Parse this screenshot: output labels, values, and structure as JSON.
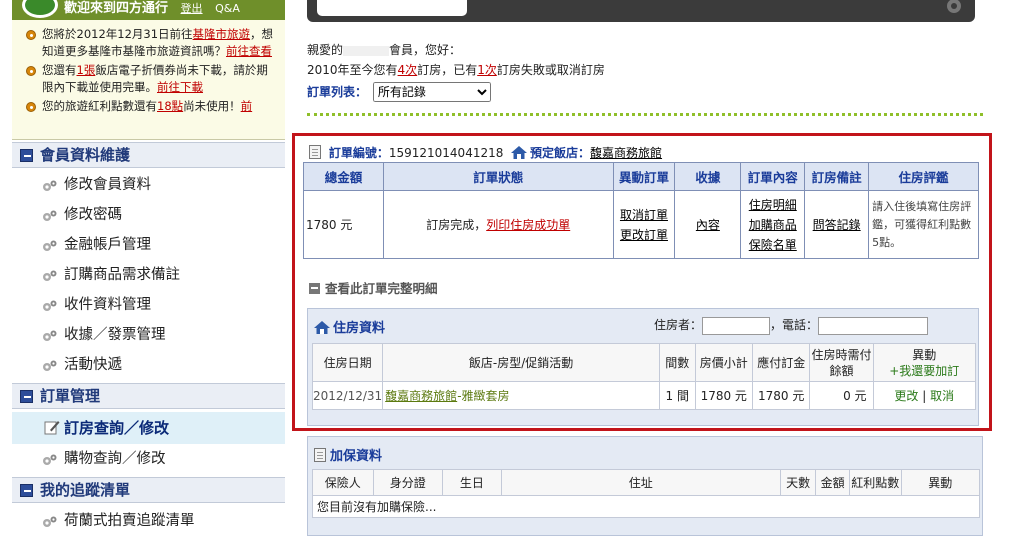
{
  "sidebar": {
    "welcome": "歡迎來到四方通行",
    "logout": "登出",
    "qa": "Q&A",
    "notices": [
      {
        "pre": "您將於2012年12月31日前往",
        "link": "基隆市旅遊",
        "mid": "，想知道更多基隆市基隆市旅遊資訊嗎？",
        "link2": "前往查看"
      },
      {
        "pre": "您還有",
        "link": "1張",
        "mid": "飯店電子折價券尚未下載，請於期限內下載並使用完畢。",
        "link2": "前往下載"
      },
      {
        "pre": "您的旅遊紅利點數還有",
        "link": "18點",
        "mid": "尚未使用！",
        "link2": "前"
      }
    ],
    "sections": [
      {
        "title": "會員資料維護",
        "items": [
          "修改會員資料",
          "修改密碼",
          "金融帳戶管理",
          "訂購商品需求備註",
          "收件資料管理",
          "收據／發票管理",
          "活動快遞"
        ]
      },
      {
        "title": "訂單管理",
        "items": [
          "訂房查詢／修改",
          "購物查詢／修改"
        ]
      },
      {
        "title": "我的追蹤清單",
        "items": [
          "荷蘭式拍賣追蹤清單"
        ]
      }
    ]
  },
  "main": {
    "page_title": "訂房查詢/修改",
    "greeting": {
      "pre": "親愛的",
      "post": "會員，您好："
    },
    "summary_line": {
      "pre": "2010年至今您有",
      "count1": "4次",
      "mid": "訂房，已有",
      "count2": "1次",
      "post": "訂房失敗或取消訂房"
    },
    "filter_label": "訂單列表：",
    "filter_value": "所有記錄",
    "order": {
      "no_label": "訂單編號：",
      "no": "1591210140412​18",
      "hotel_label": "預定飯店：",
      "hotel": "馥嘉商務旅館"
    },
    "summary_headers": [
      "總金額",
      "訂單狀態",
      "異動訂單",
      "收據",
      "訂單內容",
      "訂房備註",
      "住房評鑑"
    ],
    "summary_row": {
      "total": "1780 元",
      "status_pre": "訂房完成，",
      "status_link": "列印住房成功單",
      "change1": "取消訂單",
      "change2": "更改訂單",
      "receipt": "內容",
      "content1": "住房明細",
      "content2": "加購商品",
      "content3": "保險名單",
      "remark": "問答記錄",
      "review": "請入住後填寫住房評鑑，可獲得紅利點數5點。"
    },
    "detail_toggle": "查看此訂單完整明細",
    "stay": {
      "title": "住房資料",
      "guest_label": "住房者：",
      "phone_label": "，電話：",
      "headers": [
        "住房日期",
        "飯店-房型/促銷活動",
        "間數",
        "房價小計",
        "應付訂金",
        "住房時需付餘額",
        "異動"
      ],
      "add_link": "+我還要加訂",
      "row": {
        "date": "2012/12/31",
        "hotel_link": "馥嘉商務旅館",
        "room": "-雅緻套房",
        "rooms": "1 間",
        "subtotal": "1780 元",
        "deposit": "1780 元",
        "balance": "0 元",
        "edit": "更改",
        "sep": "|",
        "cancel": "取消"
      }
    },
    "insurance": {
      "title": "加保資料",
      "headers": [
        "保險人",
        "身分證",
        "生日",
        "住址",
        "天數",
        "金額",
        "紅利點數",
        "異動"
      ],
      "empty": "您目前沒有加購保險..."
    }
  }
}
